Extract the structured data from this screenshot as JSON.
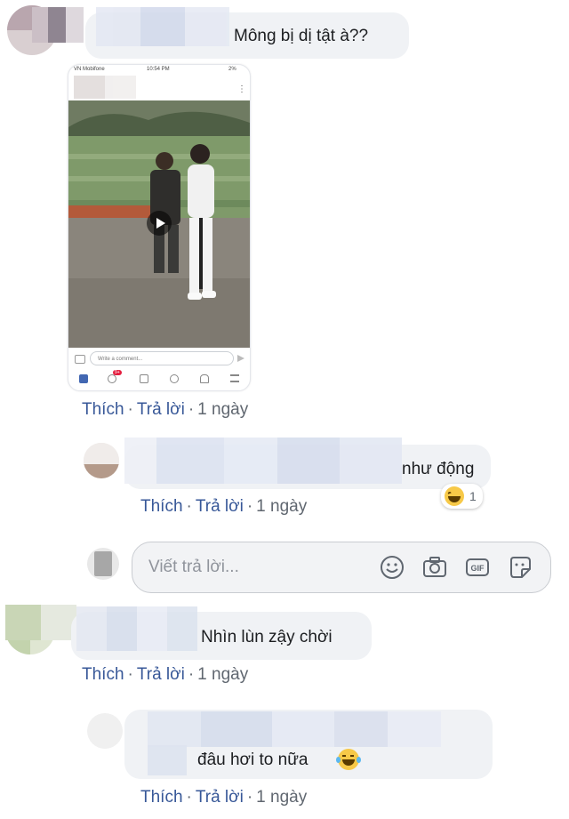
{
  "actions": {
    "like": "Thích",
    "reply": "Trả lời",
    "sep": "·",
    "time": "1 ngày"
  },
  "comments": [
    {
      "text": "Mông bị dị tật à??"
    },
    {
      "text": "như động"
    },
    {
      "text": "Nhìn lùn zậy chời"
    },
    {
      "text": "đâu hơi to nữa"
    }
  ],
  "reaction": {
    "count": "1",
    "icon": "laugh-emoji-icon"
  },
  "reply_box": {
    "placeholder": "Viết trả lời..."
  },
  "phone_screenshot": {
    "carrier": "VN Mobifone",
    "clock": "10:54 PM",
    "battery": "2%",
    "comment_placeholder": "Write a comment...",
    "notif_badge": "9+"
  },
  "colors": {
    "link": "#385898",
    "bubble": "#f0f2f5",
    "meta": "#606770"
  }
}
